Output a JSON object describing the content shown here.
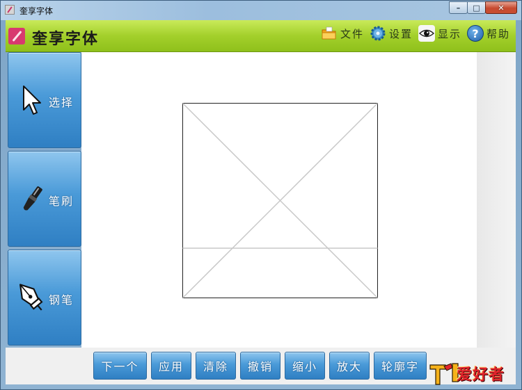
{
  "window": {
    "title": "奎享字体"
  },
  "app": {
    "title": "奎享字体",
    "menu": [
      {
        "key": "file",
        "label": "文件",
        "icon": "folder-icon"
      },
      {
        "key": "settings",
        "label": "设置",
        "icon": "gear-icon"
      },
      {
        "key": "display",
        "label": "显示",
        "icon": "eye-icon"
      },
      {
        "key": "help",
        "label": "帮助",
        "icon": "help-icon"
      }
    ]
  },
  "tools": [
    {
      "key": "select",
      "label": "选择",
      "icon": "cursor-icon"
    },
    {
      "key": "brush",
      "label": "笔刷",
      "icon": "brush-icon"
    },
    {
      "key": "pen",
      "label": "钢笔",
      "icon": "pen-nib-icon"
    }
  ],
  "actions": [
    {
      "key": "next",
      "label": "下一个"
    },
    {
      "key": "apply",
      "label": "应用"
    },
    {
      "key": "clear",
      "label": "清除"
    },
    {
      "key": "undo",
      "label": "撤销"
    },
    {
      "key": "zoom-out",
      "label": "缩小"
    },
    {
      "key": "zoom-in",
      "label": "放大"
    },
    {
      "key": "outline",
      "label": "轮廓字"
    }
  ],
  "watermark": {
    "text": "爱好者"
  },
  "colors": {
    "toolbar_green": "#a3d02b",
    "tool_blue": "#4a9ad8",
    "canvas": "#ffffff"
  }
}
